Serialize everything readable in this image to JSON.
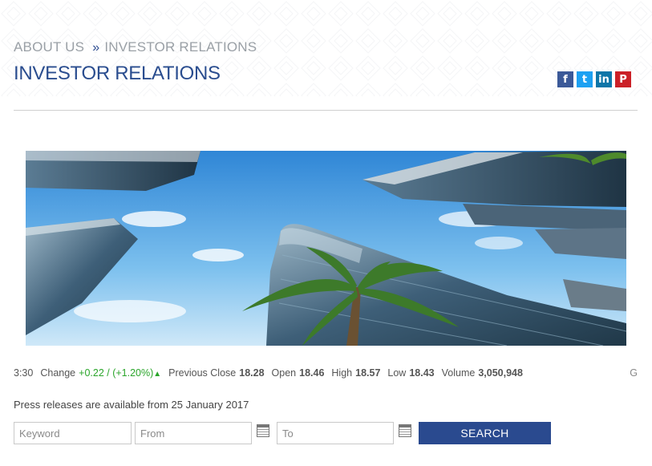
{
  "breadcrumb": {
    "parent": "ABOUT US",
    "separator": "»",
    "current": "INVESTOR RELATIONS"
  },
  "page_title": "INVESTOR RELATIONS",
  "social": {
    "facebook": "f",
    "twitter": "t",
    "linkedin": "in",
    "pinterest": "P"
  },
  "ticker": {
    "time": "3:30",
    "change_label": "Change",
    "change_value": "+0.22 / (+1.20%)",
    "prev_close_label": "Previous Close",
    "prev_close_value": "18.28",
    "open_label": "Open",
    "open_value": "18.46",
    "high_label": "High",
    "high_value": "18.57",
    "low_label": "Low",
    "low_value": "18.43",
    "volume_label": "Volume",
    "volume_value": "3,050,948",
    "trailing": "G"
  },
  "press_note": "Press releases are available from 25 January 2017",
  "search": {
    "keyword_placeholder": "Keyword",
    "from_placeholder": "From",
    "to_placeholder": "To",
    "button_label": "SEARCH"
  },
  "colors": {
    "brand": "#2a4a8f",
    "up": "#2aa52a",
    "title": "#2a4d8f"
  }
}
